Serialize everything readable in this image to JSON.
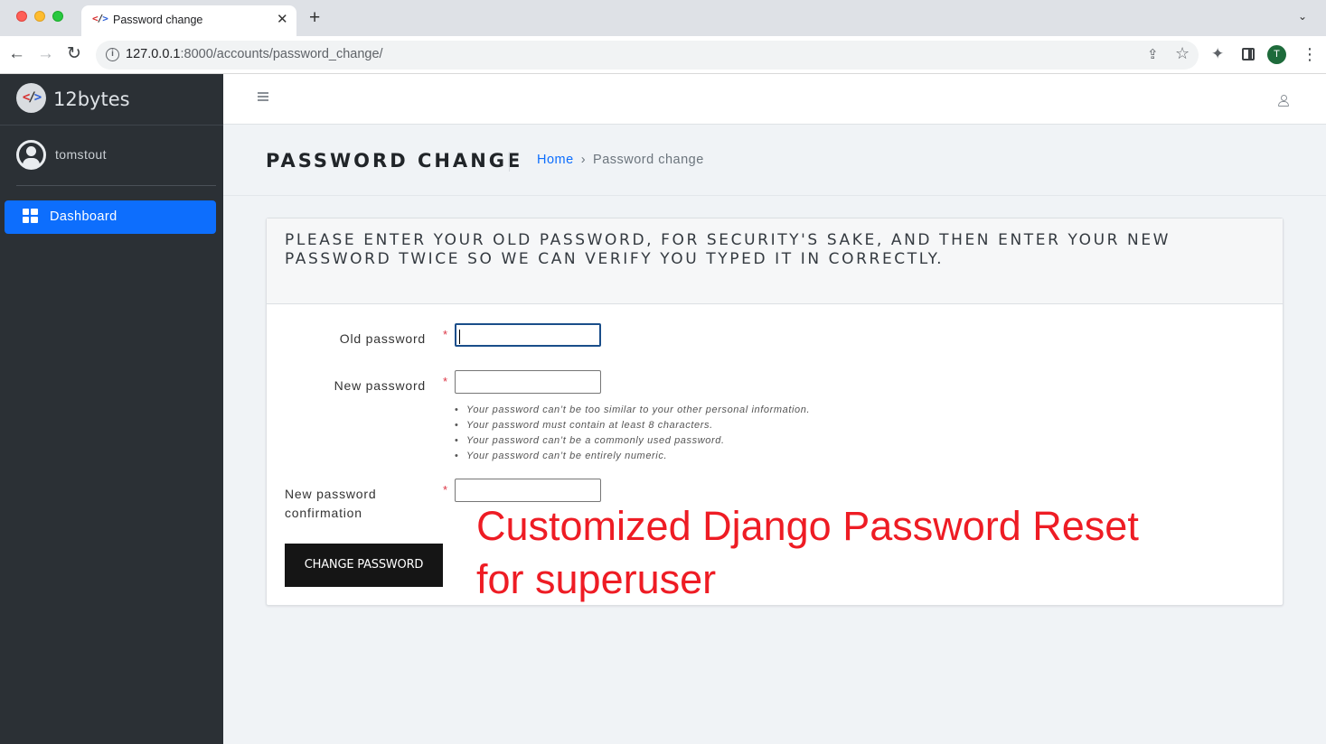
{
  "browser": {
    "tab_title": "Password change",
    "tab_close": "✕",
    "new_tab": "+",
    "tab_menu": "⌄",
    "url_host": "127.0.0.1",
    "url_rest": ":8000/accounts/password_change/",
    "profile_initial": "T"
  },
  "sidebar": {
    "brand": "12bytes",
    "user": "tomstout",
    "nav": [
      {
        "label": "Dashboard",
        "icon": "dashboard-grid-icon",
        "active": true
      }
    ]
  },
  "header": {
    "title": "PASSWORD CHANGE",
    "breadcrumb_home": "Home",
    "breadcrumb_sep": "›",
    "breadcrumb_current": "Password change"
  },
  "form": {
    "intro": "Please enter your old password, for security's sake, and then enter your new password twice so we can verify you typed it in correctly.",
    "required_mark": "*",
    "old_password_label": "Old password",
    "old_password_value": "",
    "new_password_label": "New password",
    "new_password_value": "",
    "confirm_label_line1": "New password",
    "confirm_label_line2": "confirmation",
    "confirm_value": "",
    "help": [
      "Your password can’t be too similar to your other personal information.",
      "Your password must contain at least 8 characters.",
      "Your password can’t be a commonly used password.",
      "Your password can’t be entirely numeric."
    ],
    "submit_label": "CHANGE PASSWORD"
  },
  "overlay": {
    "line1": "Customized Django Password Reset",
    "line2": "for superuser",
    "color": "#ee1c24"
  },
  "colors": {
    "accent": "#0d6efd",
    "sidebar_bg": "#2b3035",
    "required": "#dc3545"
  }
}
